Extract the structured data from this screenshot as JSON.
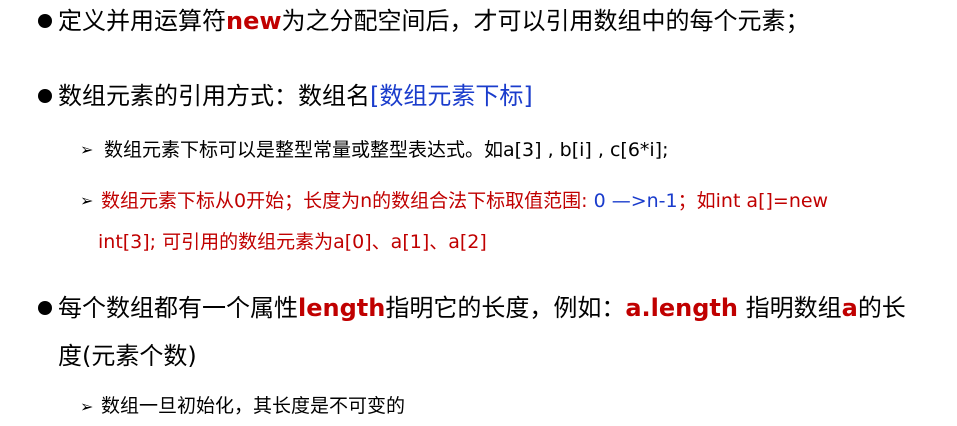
{
  "colors": {
    "text": "#000000",
    "emphasis_red": "#c00000",
    "bracket_blue": "#1a3ccc",
    "background": "#ffffff"
  },
  "bullet1": {
    "pre": "定义并用运算符",
    "keyword": "new",
    "post": "为之分配空间后，才可以引用数组中的每个元素；"
  },
  "bullet2": {
    "pre": "数组元素的引用方式：数组名",
    "bracket_text": "[数组元素下标]"
  },
  "sub1": {
    "arrow": "➢",
    "text": "数组元素下标可以是整型常量或整型表达式。如a[3] , b[i] , c[6*i];"
  },
  "sub2": {
    "arrow": "➢",
    "pre": "数组元素下标从0开始；长度为n的数组合法下标取值范围: ",
    "range": "0 —>n-1",
    "post": "；如int a[]=new",
    "line2": "int[3];  可引用的数组元素为a[0]、a[1]、a[2]"
  },
  "bullet3": {
    "pre": "每个数组都有一个属性",
    "keyword": "length",
    "mid": "指明它的长度，例如：",
    "expr": "a.length",
    "mid2": " 指明数组",
    "var": "a",
    "post": "的长",
    "line2": "度(元素个数)"
  },
  "sub3": {
    "arrow": "➢",
    "text": "数组一旦初始化，其长度是不可变的"
  }
}
